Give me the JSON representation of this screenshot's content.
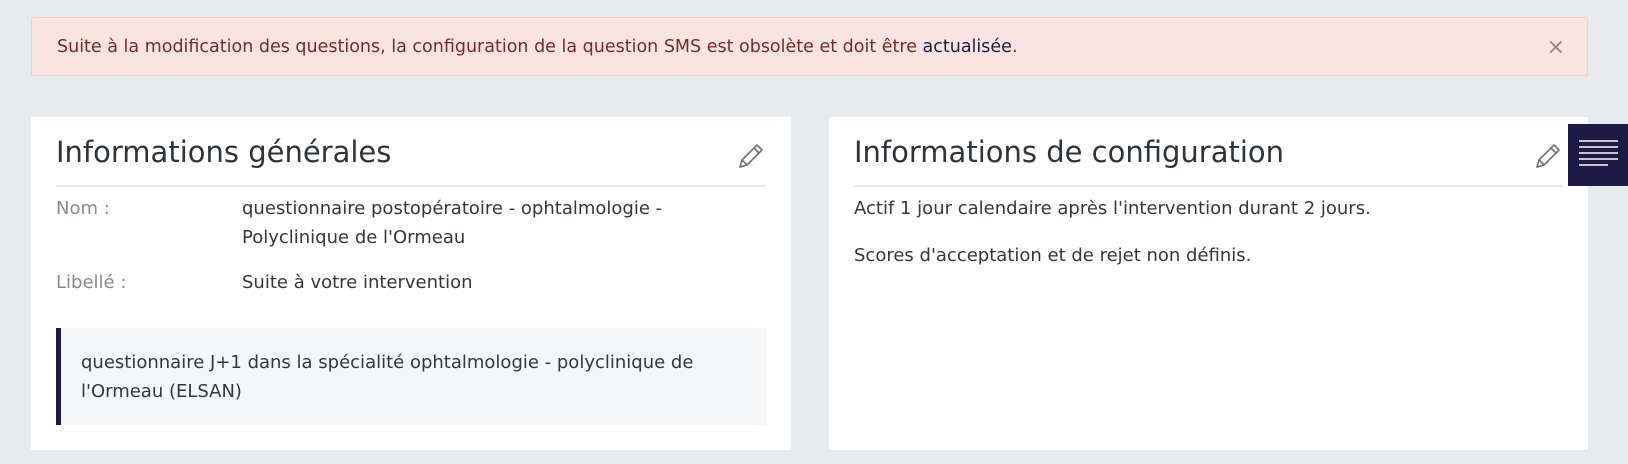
{
  "alert": {
    "message": "Suite à la modification des questions, la configuration de la question SMS est obsolète et doit être ",
    "link_text": "actualisée",
    "suffix": ".",
    "close_symbol": "×"
  },
  "general_info": {
    "title": "Informations générales",
    "edit_icon": "pencil-icon",
    "fields": [
      {
        "label": "Nom :",
        "value": "questionnaire postopératoire - ophtalmologie - Polyclinique de l'Ormeau"
      },
      {
        "label": "Libellé :",
        "value": "Suite à votre intervention"
      }
    ],
    "description": "questionnaire J+1 dans la spécialité ophtalmologie - polyclinique de l'Ormeau (ELSAN)"
  },
  "config_info": {
    "title": "Informations de configuration",
    "edit_icon": "pencil-icon",
    "lines": [
      "Actif 1 jour calendaire après l'intervention durant 2 jours.",
      "Scores d'acceptation et de rejet non définis."
    ]
  },
  "side_menu": {
    "icon": "menu-lines-icon"
  },
  "colors": {
    "brand_dark": "#1e1a45",
    "alert_bg": "#f9e4e2",
    "alert_text": "#7a2a25",
    "page_bg": "#e8ebee"
  }
}
